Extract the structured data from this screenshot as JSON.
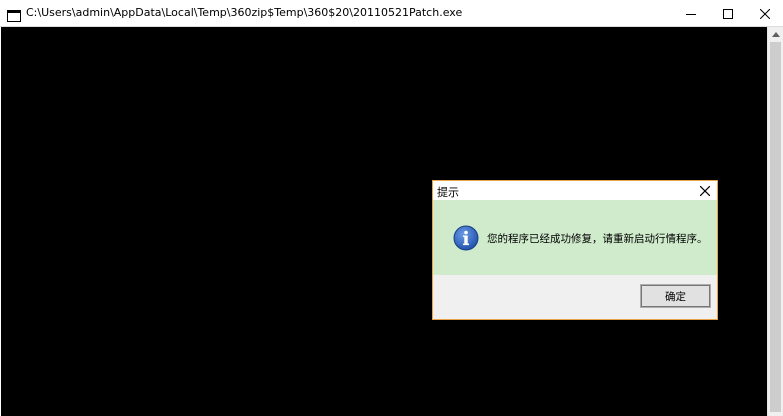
{
  "window": {
    "title": "C:\\Users\\admin\\AppData\\Local\\Temp\\360zip$Temp\\360$20\\20110521Patch.exe",
    "icons": [
      "console-app-icon",
      "minimize-icon",
      "maximize-icon",
      "close-icon",
      "scroll-up-arrow-icon"
    ]
  },
  "dialog": {
    "title": "提示",
    "message": "您的程序已经成功修复，请重新启动行情程序。",
    "ok_label": "确定",
    "icons": [
      "info-icon",
      "close-icon"
    ]
  },
  "colors": {
    "console_background": "#000000",
    "dialog_border": "#e8a24a",
    "dialog_body_background": "#d0ebcc",
    "info_icon_blue": "#2a5fb8"
  }
}
